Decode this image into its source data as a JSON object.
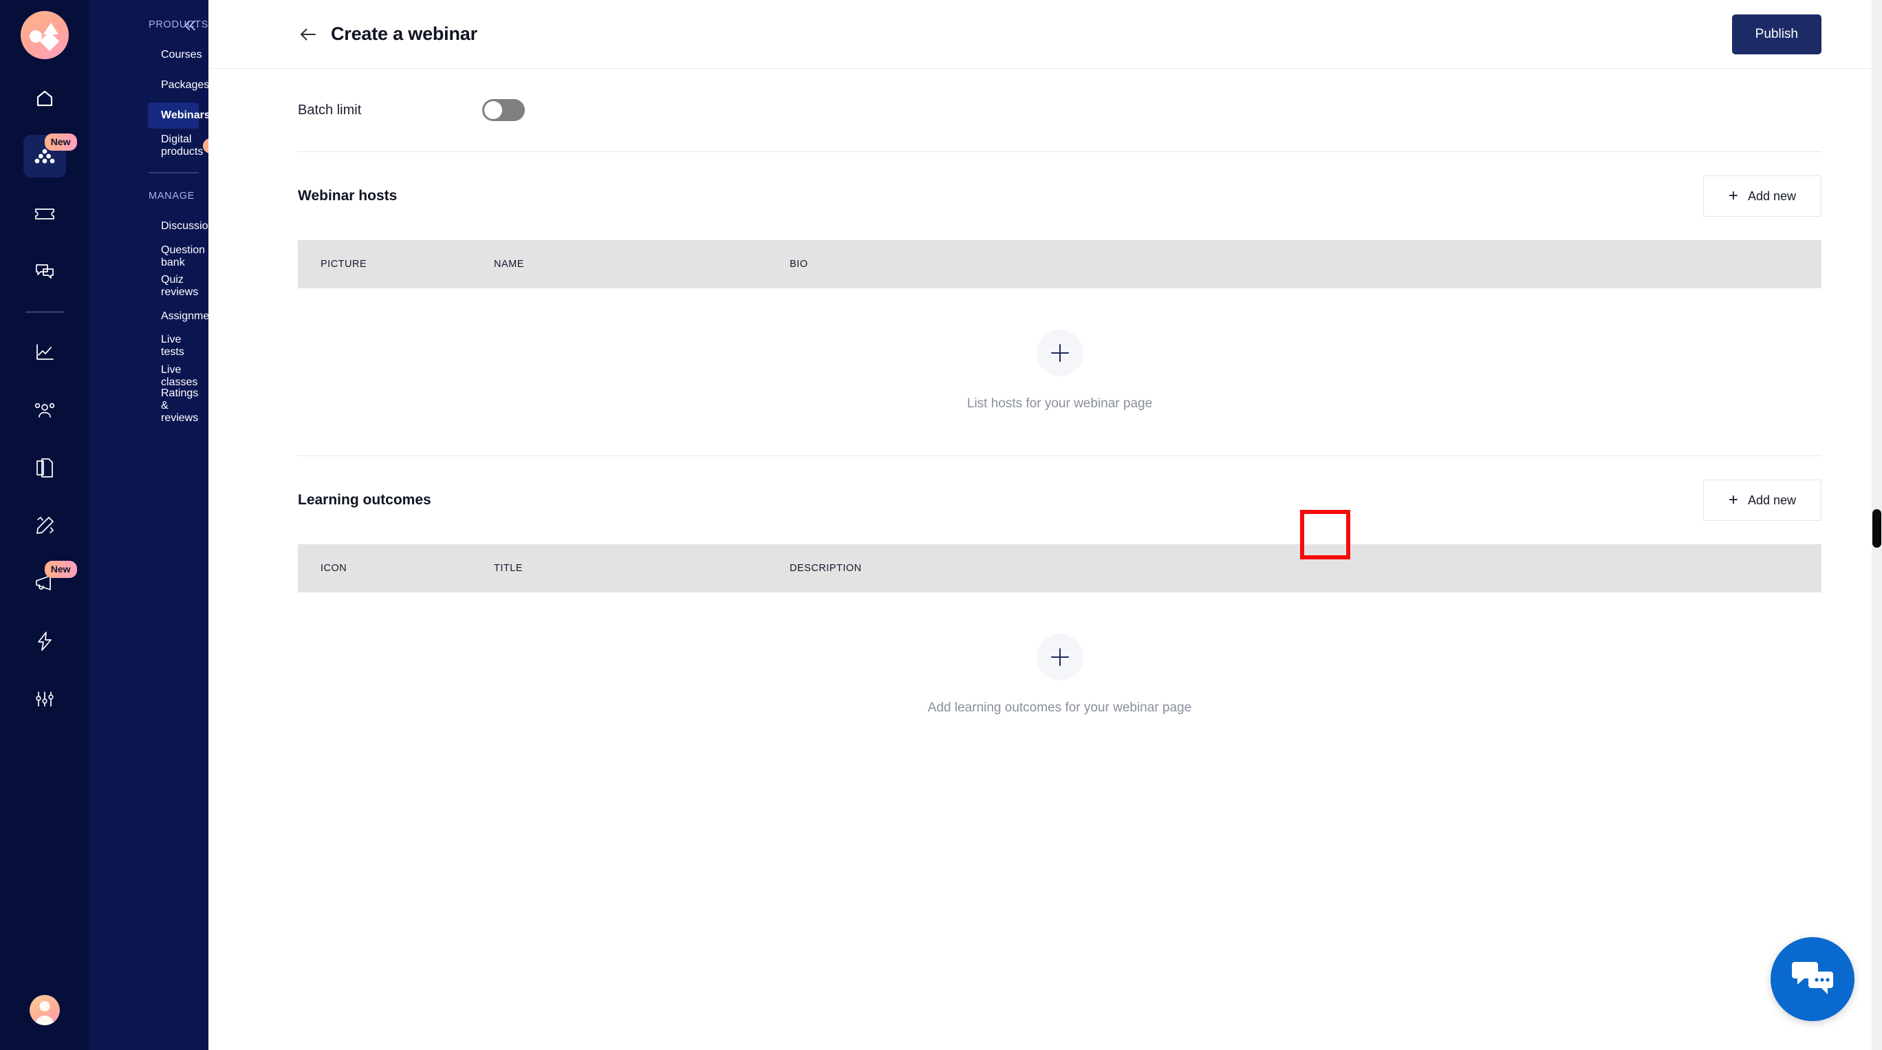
{
  "rail": {
    "logo_icon": "brand-shapes-logo",
    "items": [
      {
        "icon": "home-icon",
        "name": "home",
        "badge": null,
        "active": false
      },
      {
        "icon": "products-group-icon",
        "name": "products",
        "badge": "New",
        "active": true
      },
      {
        "icon": "ticket-icon",
        "name": "coupons",
        "badge": null,
        "active": false
      },
      {
        "icon": "chat-bubbles-icon",
        "name": "messages",
        "badge": null,
        "active": false
      },
      {
        "icon": "analytics-chart-icon",
        "name": "analytics",
        "badge": null,
        "active": false
      },
      {
        "icon": "users-icon",
        "name": "learners",
        "badge": null,
        "active": false
      },
      {
        "icon": "pages-copy-icon",
        "name": "pages",
        "badge": null,
        "active": false
      },
      {
        "icon": "pencil-design-icon",
        "name": "design",
        "badge": null,
        "active": false
      },
      {
        "icon": "megaphone-icon",
        "name": "marketing",
        "badge": "New",
        "active": false
      },
      {
        "icon": "lightning-bolt-icon",
        "name": "automations",
        "badge": null,
        "active": false
      },
      {
        "icon": "sliders-settings-icon",
        "name": "settings",
        "badge": null,
        "active": false
      }
    ],
    "avatar_icon": "user-avatar"
  },
  "sidebar": {
    "products_label": "PRODUCTS",
    "collapse_icon": "chevron-double-left-icon",
    "products": [
      {
        "label": "Courses",
        "active": false,
        "badge": null
      },
      {
        "label": "Packages",
        "active": false,
        "badge": null
      },
      {
        "label": "Webinars",
        "active": true,
        "badge": null
      },
      {
        "label": "Digital products",
        "active": false,
        "badge": "New"
      }
    ],
    "manage_label": "MANAGE",
    "manage": [
      {
        "label": "Discussions"
      },
      {
        "label": "Question bank"
      },
      {
        "label": "Quiz reviews"
      },
      {
        "label": "Assignments"
      },
      {
        "label": "Live tests"
      },
      {
        "label": "Live classes"
      },
      {
        "label": "Ratings & reviews"
      }
    ]
  },
  "topbar": {
    "back_icon": "arrow-left-icon",
    "title": "Create a webinar",
    "publish_label": "Publish"
  },
  "batch_limit": {
    "label": "Batch limit",
    "toggle_state": "off"
  },
  "webinar_hosts": {
    "title": "Webinar hosts",
    "add_new_label": "Add new",
    "plus_glyph": "+",
    "columns": [
      "PICTURE",
      "NAME",
      "BIO"
    ],
    "rows": [],
    "empty_text": "List hosts for your webinar page",
    "add_icon": "plus-icon"
  },
  "learning_outcomes": {
    "title": "Learning outcomes",
    "add_new_label": "Add new",
    "plus_glyph": "+",
    "columns": [
      "ICON",
      "TITLE",
      "DESCRIPTION"
    ],
    "rows": [],
    "empty_text": "Add learning outcomes for your webinar page",
    "add_icon": "plus-icon"
  },
  "chat_widget": {
    "icon": "chat-bubbles-icon",
    "color": "#0a69ce"
  },
  "annotation": {
    "highlight_color": "#f60b0b",
    "target": "webinar-hosts-add-plus-button"
  },
  "theme": {
    "rail_bg": "#060e3a",
    "nav_bg": "#0b1550",
    "nav_active": "#152a80",
    "publish_bg": "#1c2a66",
    "table_head_bg": "#e3e3e3",
    "badge_gradient_start": "#ffb184",
    "badge_gradient_end": "#ff9fc0"
  }
}
